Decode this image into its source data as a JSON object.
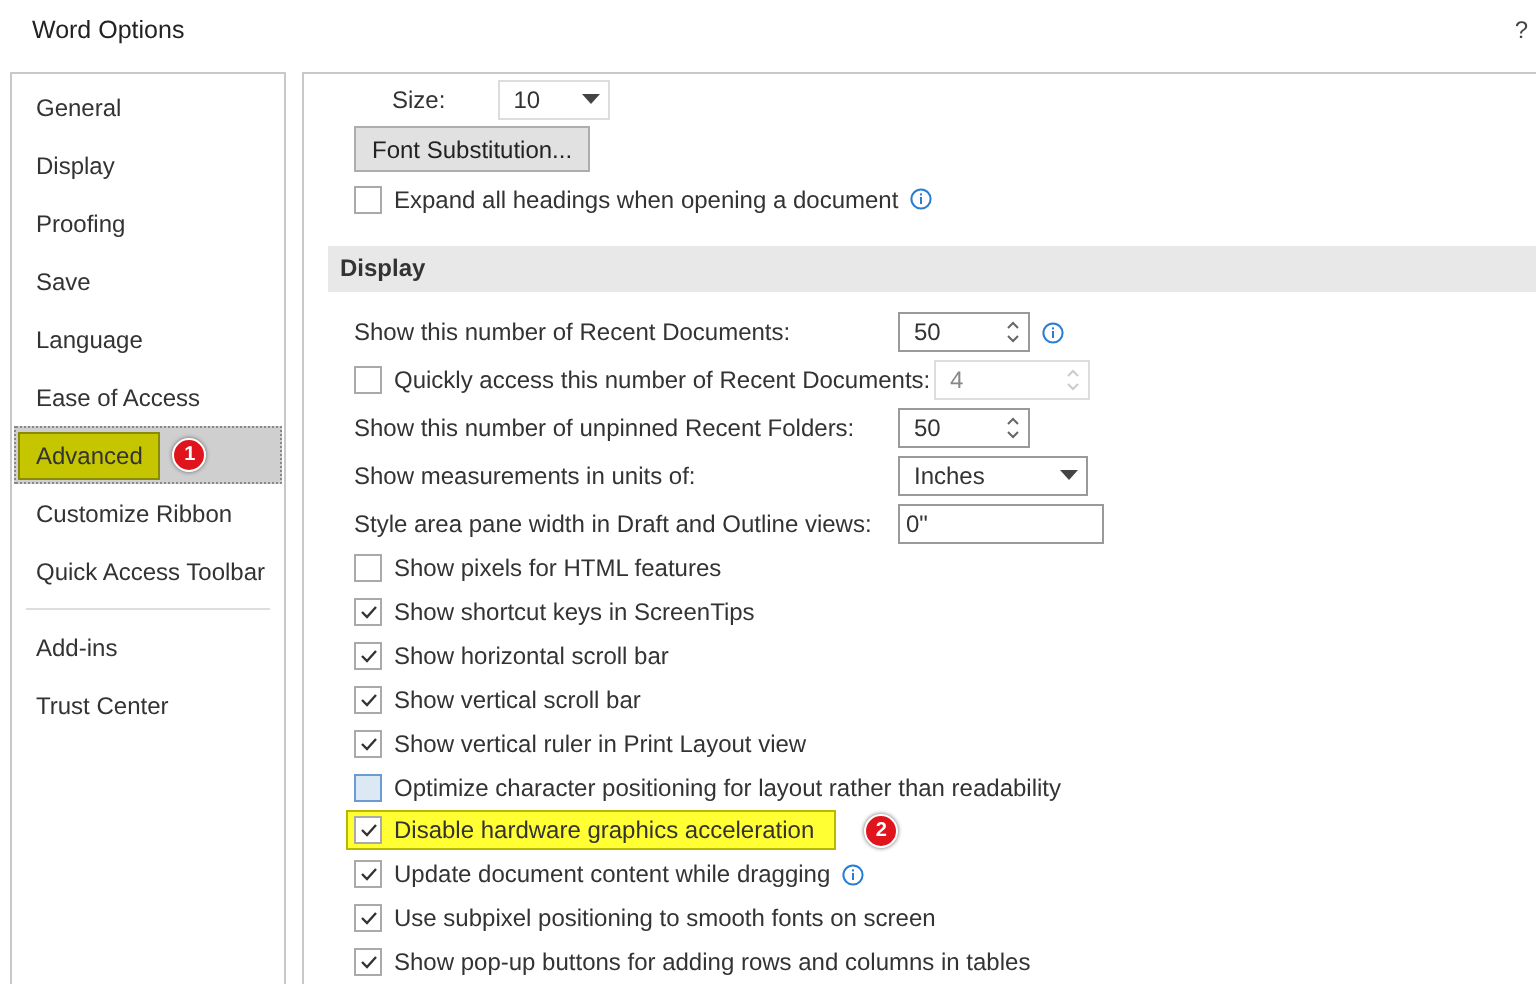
{
  "window": {
    "title": "Word Options",
    "help": "?"
  },
  "sidebar": {
    "items": [
      {
        "label": "General",
        "selected": false,
        "highlighted": false
      },
      {
        "label": "Display",
        "selected": false,
        "highlighted": false
      },
      {
        "label": "Proofing",
        "selected": false,
        "highlighted": false
      },
      {
        "label": "Save",
        "selected": false,
        "highlighted": false
      },
      {
        "label": "Language",
        "selected": false,
        "highlighted": false
      },
      {
        "label": "Ease of Access",
        "selected": false,
        "highlighted": false
      },
      {
        "label": "Advanced",
        "selected": true,
        "highlighted": true,
        "badge": "1"
      },
      {
        "label": "Customize Ribbon",
        "selected": false,
        "highlighted": false
      },
      {
        "label": "Quick Access Toolbar",
        "selected": false,
        "highlighted": false,
        "divider_after": true
      },
      {
        "label": "Add-ins",
        "selected": false,
        "highlighted": false
      },
      {
        "label": "Trust Center",
        "selected": false,
        "highlighted": false
      }
    ]
  },
  "top_section": {
    "size_label": "Size:",
    "size_value": "10",
    "font_substitution_button": "Font Substitution...",
    "expand_headings": {
      "label": "Expand all headings when opening a document",
      "checked": false,
      "info": true
    }
  },
  "display_section": {
    "title": "Display",
    "rows": [
      {
        "kind": "spin",
        "label": "Show this number of Recent Documents:",
        "value": "50",
        "info": true
      },
      {
        "kind": "check-spin",
        "label": "Quickly access this number of Recent Documents:",
        "value": "4",
        "checked": false,
        "disabled": true
      },
      {
        "kind": "spin",
        "label": "Show this number of unpinned Recent Folders:",
        "value": "50",
        "info": false
      },
      {
        "kind": "select",
        "label": "Show measurements in units of:",
        "value": "Inches"
      },
      {
        "kind": "text",
        "label": "Style area pane width in Draft and Outline views:",
        "value": "0\""
      },
      {
        "kind": "check",
        "label": "Show pixels for HTML features",
        "checked": false
      },
      {
        "kind": "check",
        "label": "Show shortcut keys in ScreenTips",
        "checked": true
      },
      {
        "kind": "check",
        "label": "Show horizontal scroll bar",
        "checked": true
      },
      {
        "kind": "check",
        "label": "Show vertical scroll bar",
        "checked": true
      },
      {
        "kind": "check",
        "label": "Show vertical ruler in Print Layout view",
        "checked": true
      },
      {
        "kind": "check",
        "label": "Optimize character positioning for layout rather than readability",
        "checked": false,
        "hovered": true
      },
      {
        "kind": "check",
        "label": "Disable hardware graphics acceleration",
        "checked": true,
        "highlighted": true,
        "badge": "2"
      },
      {
        "kind": "check",
        "label": "Update document content while dragging",
        "checked": true,
        "info": true
      },
      {
        "kind": "check",
        "label": "Use subpixel positioning to smooth fonts on screen",
        "checked": true
      },
      {
        "kind": "check",
        "label": "Show pop-up buttons for adding rows and columns in tables",
        "checked": true
      }
    ]
  }
}
